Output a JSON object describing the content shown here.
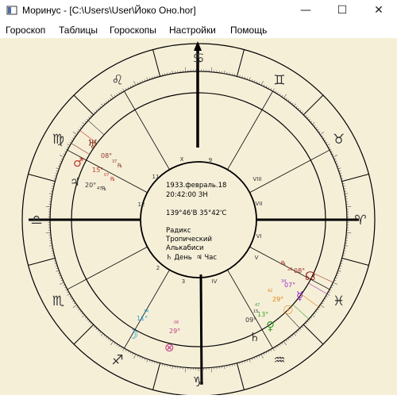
{
  "window": {
    "title": "Моринус - [C:\\Users\\User\\Йоко Оно.hor]",
    "minimize_glyph": "—",
    "maximize_glyph": "☐",
    "close_glyph": "✕"
  },
  "menu": {
    "items": [
      "Гороскоп",
      "Таблицы",
      "Гороскопы",
      "Настройки",
      "Помощь"
    ]
  },
  "chart": {
    "center": {
      "date": "1933.февраль.18",
      "time": "20:42:00 ЗН",
      "coords": "139°46'В  35°42'С",
      "type": "Радикс",
      "zodiac": "Тропический",
      "houses": "Алькабиси",
      "day_label": "♄ День",
      "hour_label": "♃ Час"
    },
    "houses": [
      "I",
      "II",
      "III",
      "IV",
      "V",
      "VI",
      "VII",
      "VIII",
      "IX",
      "X",
      "XI",
      "XII"
    ],
    "house_numbers": [
      "1",
      "2",
      "3",
      "4",
      "5",
      "6",
      "7",
      "8",
      "9",
      "10",
      "11",
      "12"
    ],
    "signs": [
      "♋",
      "♌",
      "♍",
      "♎",
      "♏",
      "♐",
      "♑",
      "♒",
      "♓",
      "♈",
      "♉",
      "♊"
    ],
    "planets": {
      "uranus": {
        "glyph": "♅",
        "deg": "08°",
        "min": "37",
        "retro": "℞"
      },
      "mars": {
        "glyph": "♂",
        "deg": "15°",
        "min": "07",
        "retro": "℞"
      },
      "jupiter": {
        "glyph": "♃",
        "deg": "20°",
        "min": "47",
        "retro": "℞"
      },
      "node": {
        "glyph": "☊",
        "deg": "08°",
        "min": "20",
        "retro": "℞"
      },
      "mercury": {
        "glyph": "☿",
        "deg": "07°",
        "min": "34"
      },
      "sun": {
        "glyph": "☉",
        "deg": "29°",
        "min": "42"
      },
      "venus": {
        "glyph": "♀",
        "deg": "13°",
        "min": "47"
      },
      "saturn": {
        "glyph": "♄",
        "deg": "09°",
        "min": "15"
      },
      "moon": {
        "glyph": "☽",
        "deg": "11°",
        "min": "14"
      },
      "fortune": {
        "glyph": "⊗",
        "deg": "29°",
        "min": "06"
      }
    },
    "colors": {
      "background": "#f6efd8",
      "uranus": "#8a3a2a",
      "mars": "#c0392b",
      "jupiter": "#333333",
      "node": "#a0302a",
      "mercury": "#9b30c8",
      "sun": "#e08010",
      "venus": "#3aa030",
      "saturn": "#333333",
      "moon": "#20a8e0",
      "fortune": "#c04080"
    }
  }
}
